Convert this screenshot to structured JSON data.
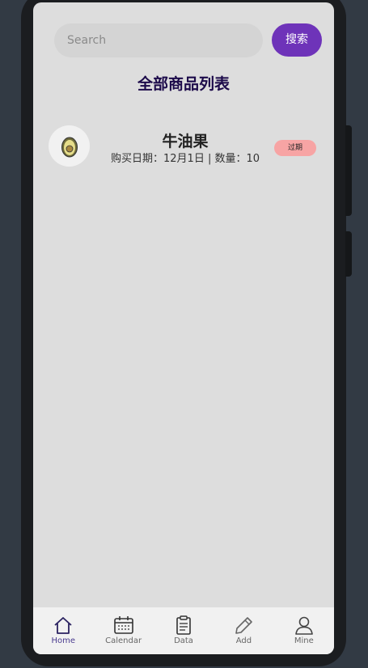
{
  "search": {
    "placeholder": "Search",
    "button_label": "搜索"
  },
  "page": {
    "title": "全部商品列表"
  },
  "items": [
    {
      "icon": "avocado-icon",
      "name": "牛油果",
      "meta": "购买日期：12月1日 | 数量：10",
      "badge": "过期",
      "badge_color": "#f7a4a4"
    }
  ],
  "tabbar": {
    "tabs": [
      {
        "label": "Home",
        "icon": "home-icon",
        "active": true
      },
      {
        "label": "Calendar",
        "icon": "calendar-icon",
        "active": false
      },
      {
        "label": "Data",
        "icon": "clipboard-icon",
        "active": false
      },
      {
        "label": "Add",
        "icon": "pencil-icon",
        "active": false
      },
      {
        "label": "Mine",
        "icon": "user-icon",
        "active": false
      }
    ]
  },
  "colors": {
    "accent": "#6e33b9",
    "title": "#1c0a4a",
    "background": "#dddddd"
  }
}
